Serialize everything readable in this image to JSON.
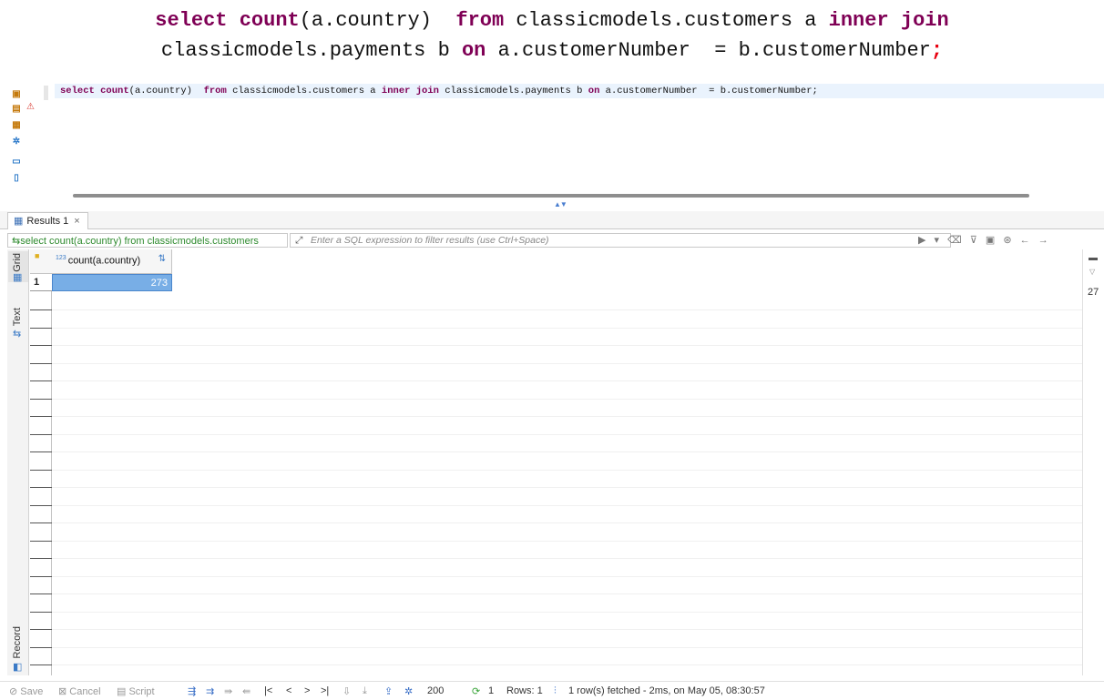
{
  "caption": {
    "line1": {
      "kw1": "select",
      "kw2": "count",
      "t1": "(a.country)  ",
      "kw3": "from",
      "t2": " classicmodels.customers a ",
      "kw4": "inner join"
    },
    "line2": {
      "t1": "classicmodels.payments b ",
      "kw1": "on",
      "t2": " a.customerNumber  = b.customerNumber",
      "semi": ";"
    }
  },
  "editor": {
    "kw1": "select",
    "kw2": "count",
    "t1": "(a.country)  ",
    "kw3": "from",
    "t2": " classicmodels.customers a ",
    "kw4": "inner join",
    "t3": " classicmodels.payments b ",
    "kw5": "on",
    "t4": " a.customerNumber  = b.customerNumber;"
  },
  "results_tab": {
    "label": "Results 1",
    "close": "×"
  },
  "filter": {
    "query_text": "select count(a.country) from classicmodels.customers",
    "placeholder": "Enter a SQL expression to filter results (use Ctrl+Space)"
  },
  "side_tabs": {
    "grid": "Grid",
    "text": "Text",
    "record": "Record"
  },
  "grid": {
    "columns": [
      {
        "type_badge": "123",
        "name": "count(a.country)"
      }
    ],
    "rows": [
      {
        "num": "1",
        "values": [
          "273"
        ]
      }
    ]
  },
  "right_panel": {
    "value": "27"
  },
  "status": {
    "save": "Save",
    "cancel": "Cancel",
    "script": "Script",
    "fetch_size": "200",
    "refresh_count": "1",
    "rows": "Rows: 1",
    "message": "1 row(s) fetched - 2ms, on May 05, 08:30:57"
  }
}
